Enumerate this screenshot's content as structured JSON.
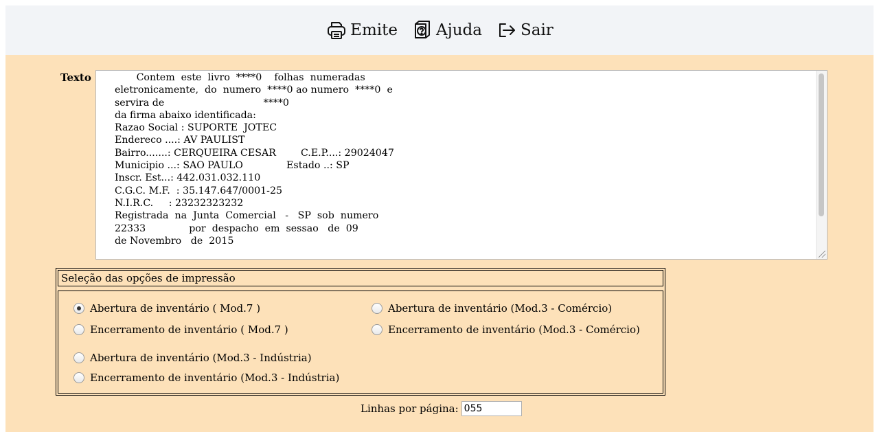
{
  "toolbar": {
    "emite_label": "Emite",
    "ajuda_label": "Ajuda",
    "sair_label": "Sair"
  },
  "texto": {
    "label": "Texto",
    "content": "       Contem  este  livro  ****0    folhas  numeradas\neletronicamente,  do  numero  ****0 ao numero  ****0  e\nservira de                                ****0\nda firma abaixo identificada:\nRazao Social : SUPORTE  JOTEC\nEndereco ....: AV PAULIST\nBairro.......: CERQUEIRA CESAR        C.E.P....: 29024047\nMunicipio ...: SAO PAULO              Estado ..: SP\nInscr. Est...: 442.031.032.110\nC.G.C. M.F.  : 35.147.647/0001-25\nN.I.R.C.     : 23232323232\nRegistrada  na  Junta  Comercial   -   SP  sob  numero\n22333              por  despacho  em  sessao   de  09\nde Novembro   de  2015"
  },
  "selecao": {
    "title": "Seleção das opções de impressão",
    "options": [
      {
        "label": "Abertura de inventário ( Mod.7 )",
        "checked": true
      },
      {
        "label": "Abertura de inventário (Mod.3 - Comércio)",
        "checked": false
      },
      {
        "label": "Encerramento de inventário ( Mod.7 )",
        "checked": false
      },
      {
        "label": "Encerramento de inventário (Mod.3 - Comércio)",
        "checked": false
      },
      {
        "label": "Abertura de inventário (Mod.3 - Indústria)",
        "checked": false
      },
      {
        "label": "Encerramento de inventário (Mod.3 - Indústria)",
        "checked": false
      }
    ]
  },
  "linhas": {
    "label": "Linhas por página:",
    "value": "055"
  }
}
